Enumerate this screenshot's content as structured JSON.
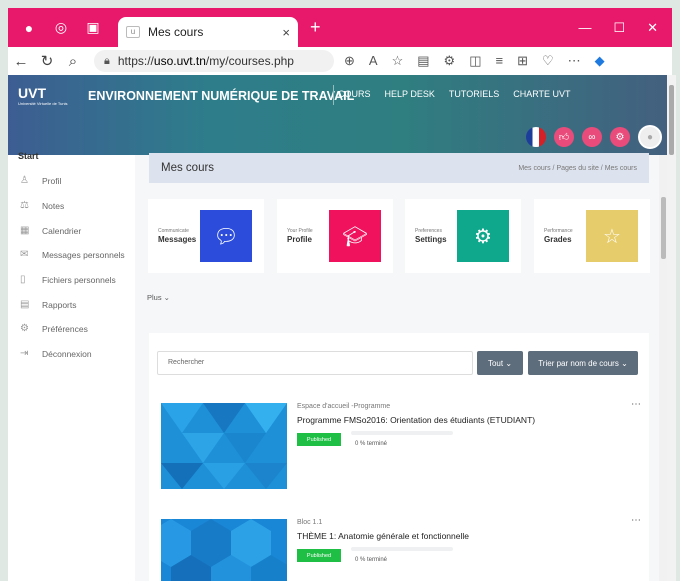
{
  "browser": {
    "tab_title": "Mes cours",
    "tab_close": "×",
    "new_tab": "+",
    "url_prefix": "https://",
    "url_host": "uso.uvt.tn",
    "url_path": "/my/courses.php"
  },
  "header": {
    "logo_text": "UVT",
    "logo_subtext": "Université Virtuelle de Tunis",
    "site_title": "ENVIRONNEMENT NUMÉRIQUE DE TRAVAIL",
    "nav": [
      "COURS",
      "HELP DESK",
      "TUTORIELS",
      "CHARTE UVT"
    ]
  },
  "sidebar": {
    "heading": "Start",
    "items": [
      {
        "label": "Profil",
        "icon": "user-icon"
      },
      {
        "label": "Notes",
        "icon": "grades-icon"
      },
      {
        "label": "Calendrier",
        "icon": "calendar-icon"
      },
      {
        "label": "Messages personnels",
        "icon": "chat-icon"
      },
      {
        "label": "Fichiers personnels",
        "icon": "file-icon"
      },
      {
        "label": "Rapports",
        "icon": "report-icon"
      },
      {
        "label": "Préférences",
        "icon": "gear-icon"
      },
      {
        "label": "Déconnexion",
        "icon": "logout-icon"
      }
    ]
  },
  "page": {
    "title": "Mes cours",
    "breadcrumb": "Mes cours / Pages du site / Mes cours"
  },
  "cards": [
    {
      "small": "Communicate",
      "big": "Messages",
      "color": "#2c4ddb",
      "icon": "chat-bubble-icon"
    },
    {
      "small": "Your Profile",
      "big": "Profile",
      "color": "#f0125c",
      "icon": "graduation-cap-icon"
    },
    {
      "small": "Preferences",
      "big": "Settings",
      "color": "#0fa88c",
      "icon": "gear-icon"
    },
    {
      "small": "Performance",
      "big": "Grades",
      "color": "#e6cc6a",
      "icon": "stars-hand-icon"
    }
  ],
  "plus_label": "Plus ⌄",
  "courses_panel": {
    "search_placeholder": "Rechercher",
    "filter_label": "Tout ⌄",
    "sort_label": "Trier par nom de cours ⌄"
  },
  "courses": [
    {
      "category": "Espace d'accueil -Programme",
      "name": "Programme FMSo2016: Orientation des étudiants (ETUDIANT)",
      "status": "Published",
      "progress_text": "0 % terminé",
      "progress": 0
    },
    {
      "category": "Bloc 1.1",
      "name": "THÈME 1: Anatomie générale et fonctionnelle",
      "status": "Published",
      "progress_text": "0 % terminé",
      "progress": 0
    }
  ]
}
